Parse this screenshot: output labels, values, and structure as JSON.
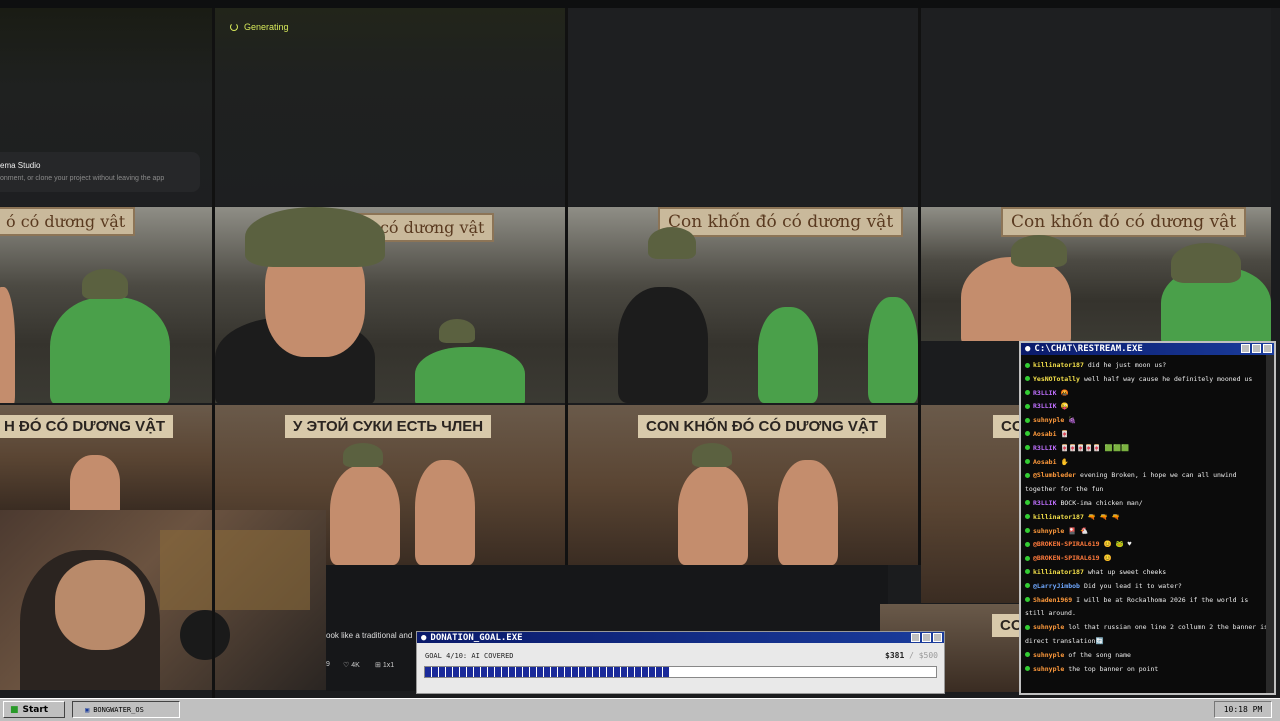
{
  "app": {
    "status_generating": "Generating",
    "studio_title": "ema Studio",
    "studio_subtitle": "onment, or clone your project without leaving the app",
    "prompt_snippet": "ook like a traditional and ",
    "stats": [
      "9",
      "4K",
      "1x1"
    ]
  },
  "image_signs": {
    "vn_partial": "ó có dương vật",
    "vn_partial2": "đó có dương vật",
    "vn_full": "Con khốn đó có dương vật",
    "ru_left": "Н ĐÓ CÓ DƯƠNG VẬT",
    "ru_mid": "У ЭТОЙ СУКИ ЕСТЬ ЧЛЕН",
    "vn_caps": "CON KHỐN ĐÓ CÓ DƯƠNG VẬT",
    "right_partial": "CON",
    "right_partial2": "CON"
  },
  "chat": {
    "title": "C:\\CHAT\\RESTREAM.EXE",
    "colors": {
      "title_bg": "#0a1a6a",
      "user_green": "#ffd24a"
    },
    "messages": [
      {
        "user": "killinator187",
        "color": "#f4e04a",
        "text": "did he just moon us?"
      },
      {
        "user": "YesNOTotally",
        "color": "#f4e04a",
        "text": "well half way cause he definitely mooned us"
      },
      {
        "user": "R3LLIK",
        "color": "#c070ff",
        "text": "🤬"
      },
      {
        "user": "R3LLIK",
        "color": "#c070ff",
        "text": "😜"
      },
      {
        "user": "suhnyple",
        "color": "#ff9a3c",
        "text": "🍇"
      },
      {
        "user": "Aosabi",
        "color": "#ff9a3c",
        "text": "🀄"
      },
      {
        "user": "R3LLIK",
        "color": "#c070ff",
        "text": "🀄🀄🀄🀄🀄 🟩🟩🟩"
      },
      {
        "user": "Aosabi",
        "color": "#ff9a3c",
        "text": "✋"
      },
      {
        "user": "@Slumbleder",
        "color": "#ff9a3c",
        "text": "evening Broken, i hope we can all unwind together for the fun",
        "wrap": true
      },
      {
        "user": "R3LLIK",
        "color": "#c070ff",
        "text": "BOCK-ima chicken man/"
      },
      {
        "user": "killinator187",
        "color": "#f4e04a",
        "text": "🔫 🔫 🔫"
      },
      {
        "user": "suhnyple",
        "color": "#ff9a3c",
        "text": "🎴 🐔"
      },
      {
        "user": "@BROKEN-SPIRAL619",
        "color": "#ff7a3c",
        "text": "😊 🐸 ♥"
      },
      {
        "user": "@BROKEN-SPIRAL619",
        "color": "#ff7a3c",
        "text": "😊"
      },
      {
        "user": "killinator187",
        "color": "#f4e04a",
        "text": "what up sweet cheeks"
      },
      {
        "user": "@LarryJimbob",
        "color": "#6fa8ff",
        "text": "Did you lead it to water?"
      },
      {
        "user": "Shaden1969",
        "color": "#ff9a3c",
        "text": "I will be at Rockalhoma 2026 if the world is still around.",
        "wrap": true
      },
      {
        "user": "suhnyple",
        "color": "#ff9a3c",
        "text": "lol that russian one line 2 collumn 2 the banner is direct translation🔄",
        "wrap": true
      },
      {
        "user": "suhnyple",
        "color": "#ff9a3c",
        "text": "of the song name"
      },
      {
        "user": "suhnyple",
        "color": "#ff9a3c",
        "text": "the top banner on point"
      }
    ]
  },
  "donation": {
    "title": "DONATION_GOAL.EXE",
    "goal_text": "GOAL 4/10: AI COVERED",
    "amount": "$381",
    "target": "/ $500",
    "progress": 0.48
  },
  "taskbar": {
    "start_label": "Start",
    "task_label": "BONGWATER_OS",
    "clock": "10:18 PM"
  }
}
